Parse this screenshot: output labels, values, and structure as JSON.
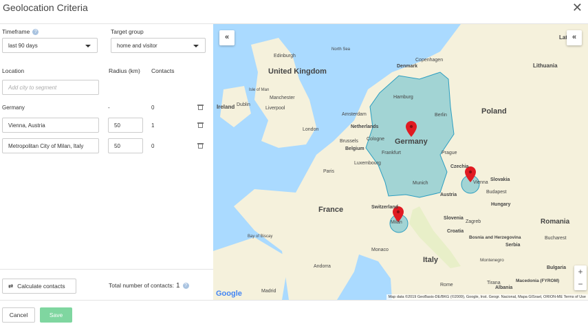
{
  "dialog": {
    "title": "Geolocation Criteria",
    "close_label": "✕"
  },
  "filters": {
    "timeframe_label": "Timeframe",
    "timeframe_value": "last 90 days",
    "target_group_label": "Target group",
    "target_group_value": "home and visitor"
  },
  "table": {
    "headers": {
      "location": "Location",
      "radius": "Radius (km)",
      "contacts": "Contacts"
    },
    "add_placeholder": "Add city to segment",
    "rows": [
      {
        "location": "Germany",
        "radius": "-",
        "contacts": "0"
      },
      {
        "location": "Vienna, Austria",
        "radius": "50",
        "contacts": "1"
      },
      {
        "location": "Metropolitan City of Milan, Italy",
        "radius": "50",
        "contacts": "0"
      }
    ]
  },
  "actions": {
    "calculate_label": "Calculate contacts",
    "total_label": "Total number of contacts:",
    "total_value": "1",
    "cancel_label": "Cancel",
    "save_label": "Save"
  },
  "map": {
    "collapse_left": "«",
    "collapse_right": "«",
    "zoom_in": "+",
    "zoom_out": "−",
    "google_logo": "Google",
    "attribution": "Map data ©2019 GeoBasis-DE/BKG (©2009), Google, Inst. Geogr. Nacional, Mapa GISrael, ORION-ME   Terms of Use",
    "labels": {
      "north_sea": "North Sea",
      "bay_of_biscay": "Bay of Biscay",
      "united_kingdom": "United Kingdom",
      "ireland": "Ireland",
      "isle_of_man": "Isle of Man",
      "edinburgh": "Edinburgh",
      "manchester": "Manchester",
      "liverpool": "Liverpool",
      "dublin": "Dublin",
      "london": "London",
      "denmark": "Denmark",
      "copenhagen": "Copenhagen",
      "hamburg": "Hamburg",
      "berlin": "Berlin",
      "amsterdam": "Amsterdam",
      "netherlands": "Netherlands",
      "brussels": "Brussels",
      "cologne": "Cologne",
      "belgium": "Belgium",
      "luxembourg": "Luxembourg",
      "frankfurt": "Frankfurt",
      "germany": "Germany",
      "prague": "Prague",
      "czechia": "Czechia",
      "munich": "Munich",
      "vienna": "Vienna",
      "slovakia": "Slovakia",
      "austria": "Austria",
      "budapest": "Budapest",
      "hungary": "Hungary",
      "poland": "Poland",
      "lithuania": "Lithuania",
      "latvia": "Latvia",
      "paris": "Paris",
      "france": "France",
      "switzerland": "Switzerland",
      "milan": "Milan",
      "slovenia": "Slovenia",
      "zagreb": "Zagreb",
      "croatia": "Croatia",
      "bosnia": "Bosnia and Herzegovina",
      "serbia": "Serbia",
      "romania": "Romania",
      "bucharest": "Bucharest",
      "bulgaria": "Bulgaria",
      "montenegro": "Montenegro",
      "italy": "Italy",
      "monaco": "Monaco",
      "andorra": "Andorra",
      "madrid": "Madrid",
      "rome": "Rome",
      "albania": "Albania",
      "macedonia": "Macedonia (FYROM)",
      "tirana": "Tirana"
    }
  },
  "colors": {
    "accent": "#7fd6a0",
    "water": "#aadaff",
    "land": "#f5f1dc",
    "region": "#3fb1c9",
    "pin": "#e01b22"
  }
}
